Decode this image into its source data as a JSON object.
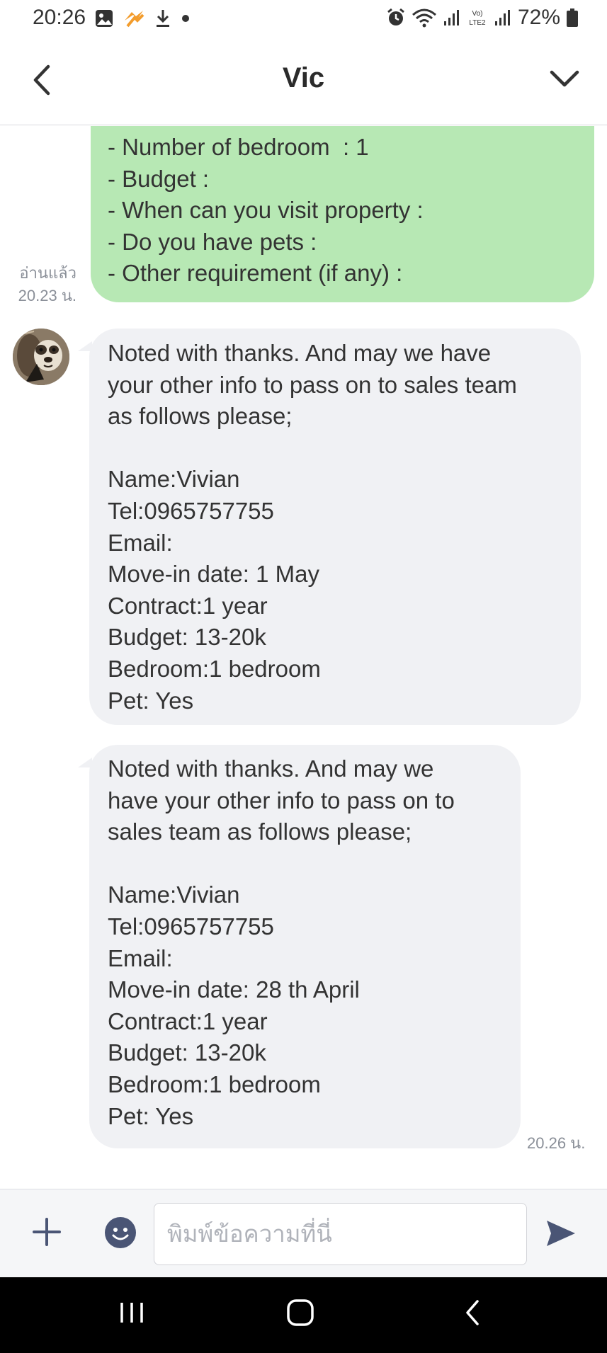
{
  "status_bar": {
    "time": "20:26",
    "battery_percent": "72%",
    "left_icons": [
      "gallery-icon",
      "app-notification-icon",
      "download-icon",
      "dot-icon"
    ],
    "right_icons": [
      "alarm-icon",
      "wifi-icon",
      "signal-icon",
      "volte-icon",
      "signal-icon",
      "battery-icon"
    ]
  },
  "header": {
    "title": "Vic"
  },
  "messages": {
    "outgoing": {
      "text": "- Number of bedroom  : 1\n- Budget :\n- When can you visit property :\n- Do you have pets :\n- Other requirement (if any) :",
      "read_label": "อ่านแล้ว",
      "time": "20.23 น.",
      "bubble_color": "#b7e8b4"
    },
    "incoming_1": {
      "text": "Noted with thanks. And may we have\nyour other info to pass on to sales team\nas follows please;\n\nName:Vivian\nTel:0965757755\nEmail:\nMove-in date: 1 May\nContract:1 year\nBudget: 13-20k\nBedroom:1 bedroom\nPet: Yes"
    },
    "incoming_2": {
      "text": "Noted with thanks. And may we\nhave your other info to pass on to\nsales team as follows please;\n\nName:Vivian\nTel:0965757755\nEmail:\nMove-in date: 28 th April\nContract:1 year\nBudget: 13-20k\nBedroom:1 bedroom\nPet: Yes",
      "time": "20.26 น."
    },
    "incoming_bubble_color": "#f0f1f4"
  },
  "input_bar": {
    "placeholder": "พิมพ์ข้อความที่นี่",
    "value": ""
  },
  "colors": {
    "accent": "#4a5575",
    "nav_background": "#000000"
  }
}
